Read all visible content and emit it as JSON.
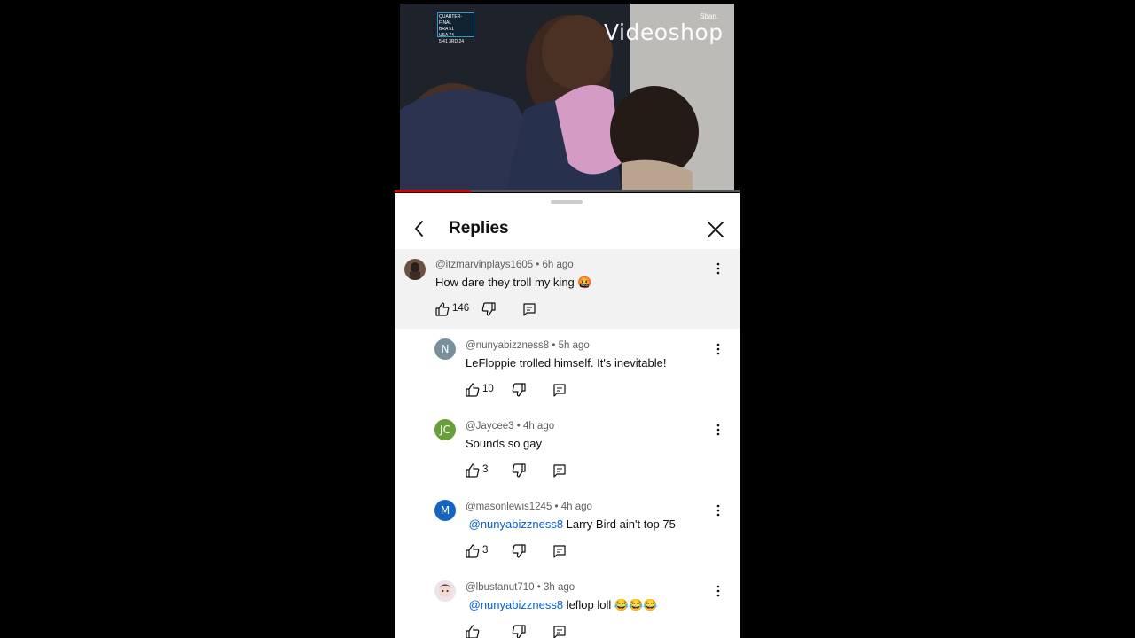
{
  "video": {
    "watermark": "Videoshop",
    "olympics_label": "Sban.",
    "scorebug": {
      "round": "QUARTER-FINAL",
      "team1": "BRA",
      "score1": "51",
      "team2": "USA",
      "score2": "74",
      "clock": "5:41",
      "period": "3RD",
      "shot_clock": "24"
    },
    "progress_fraction": 0.22
  },
  "panel": {
    "title": "Replies"
  },
  "comments": [
    {
      "handle": "@itzmarvinplays1605",
      "time": "6h ago",
      "mention": "",
      "text": "How dare they troll my king 🤬",
      "likes": "146",
      "avatar_initial": "",
      "avatar_color": "#5a4a3e"
    },
    {
      "handle": "@nunyabizzness8",
      "time": "5h ago",
      "mention": "",
      "text": "LeFloppie trolled himself.  It's inevitable!",
      "likes": "10",
      "avatar_initial": "N",
      "avatar_color": "#78909c"
    },
    {
      "handle": "@Jaycee3",
      "time": "4h ago",
      "mention": "",
      "text": "Sounds so gay",
      "likes": "3",
      "avatar_initial": "JC",
      "avatar_color": "#689f38"
    },
    {
      "handle": "@masonlewis1245",
      "time": "4h ago",
      "mention": "@nunyabizzness8",
      "text": "Larry Bird ain't top 75",
      "likes": "3",
      "avatar_initial": "M",
      "avatar_color": "#1565c0"
    },
    {
      "handle": "@lbustanut710",
      "time": "3h ago",
      "mention": "@nunyabizzness8",
      "text": " leflop loll 😂😂😂",
      "likes": "",
      "avatar_initial": "",
      "avatar_color": "#c9b8c8"
    }
  ],
  "icons": {
    "back": "chevron-left-icon",
    "close": "close-icon",
    "like": "thumbs-up-icon",
    "dislike": "thumbs-down-icon",
    "reply": "reply-icon",
    "more": "more-vertical-icon"
  },
  "colors": {
    "mention": "#065fd4",
    "highlight": "#f2f2f2",
    "progress": "#e00000"
  }
}
